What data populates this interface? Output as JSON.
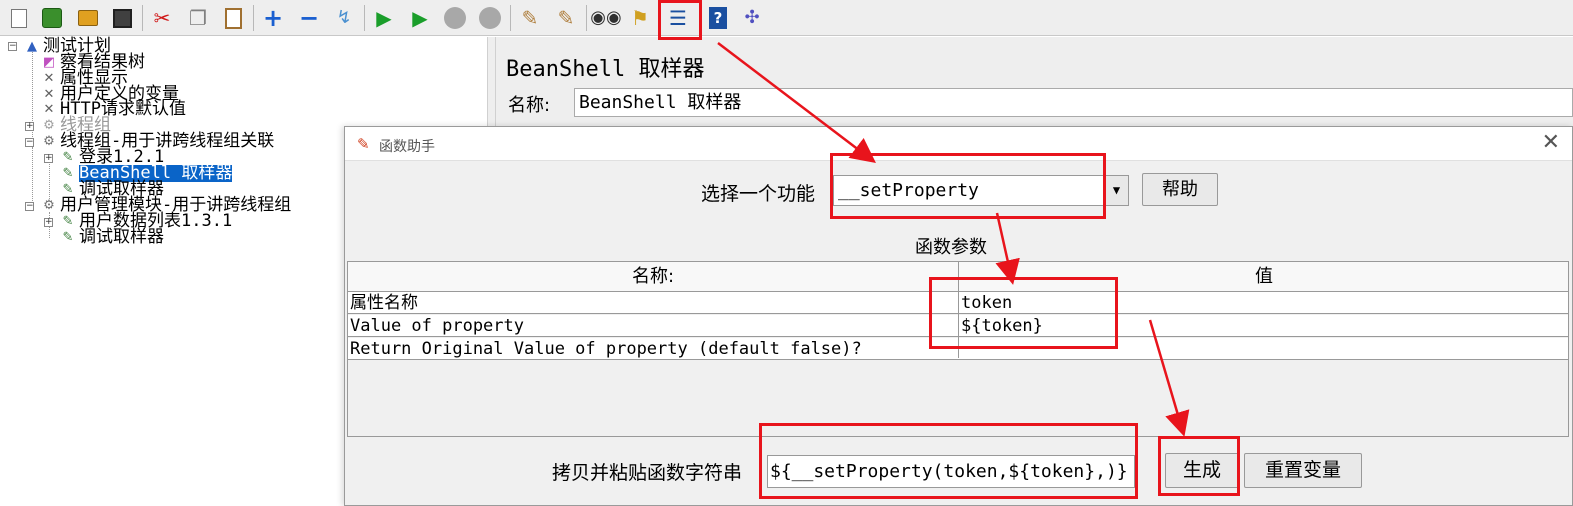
{
  "toolbar": {
    "buttons": [
      {
        "name": "new-icon",
        "glyph": "🗋",
        "color": "#ffffff"
      },
      {
        "name": "templates-icon",
        "glyph": "▦",
        "color": "#3a8f2c"
      },
      {
        "name": "open-icon",
        "glyph": "▬",
        "color": "#e0a020"
      },
      {
        "name": "save-icon",
        "glyph": "▣",
        "color": "#404040"
      },
      {
        "name": "cut-icon",
        "glyph": "✂",
        "color": "#d01818"
      },
      {
        "name": "copy-icon",
        "glyph": "❐",
        "color": "#808080"
      },
      {
        "name": "paste-icon",
        "glyph": "▤",
        "color": "#a07030"
      },
      {
        "name": "expand-icon",
        "glyph": "+",
        "color": "#1a5fd0"
      },
      {
        "name": "collapse-icon",
        "glyph": "−",
        "color": "#1a5fd0"
      },
      {
        "name": "toggle-icon",
        "glyph": "↯",
        "color": "#4a90d0"
      },
      {
        "name": "start-icon",
        "glyph": "▶",
        "color": "#1a9e2a"
      },
      {
        "name": "start-no-pause-icon",
        "glyph": "▶",
        "color": "#1a9e2a"
      },
      {
        "name": "stop-icon",
        "glyph": "⬢",
        "color": "#a0a0a0"
      },
      {
        "name": "shutdown-icon",
        "glyph": "✖",
        "color": "#a0a0a0"
      },
      {
        "name": "clear-icon",
        "glyph": "✎",
        "color": "#b08040"
      },
      {
        "name": "clear-all-icon",
        "glyph": "✎",
        "color": "#b08040"
      },
      {
        "name": "search-icon",
        "glyph": "👓",
        "color": "#303030"
      },
      {
        "name": "reset-search-icon",
        "glyph": "🧹",
        "color": "#d0a020"
      },
      {
        "name": "function-helper-icon",
        "glyph": "☰",
        "color": "#1a4fa0"
      },
      {
        "name": "help-icon",
        "glyph": "?",
        "color": "#1a4fa0"
      },
      {
        "name": "remote-icon",
        "glyph": "✣",
        "color": "#5050c0"
      }
    ]
  },
  "tree": {
    "nodes": [
      {
        "label": "测试计划",
        "icon": "flask-icon",
        "glyph": "▲",
        "color": "#3060c0",
        "depth": 0
      },
      {
        "label": "察看结果树",
        "icon": "listener-icon",
        "glyph": "◩",
        "color": "#c050c0",
        "depth": 1
      },
      {
        "label": "属性显示",
        "icon": "config-icon",
        "glyph": "✕",
        "color": "#606060",
        "depth": 1
      },
      {
        "label": "用户定义的变量",
        "icon": "config-icon",
        "glyph": "✕",
        "color": "#606060",
        "depth": 1
      },
      {
        "label": "HTTP请求默认值",
        "icon": "config-icon",
        "glyph": "✕",
        "color": "#606060",
        "depth": 1
      },
      {
        "label": "线程组",
        "icon": "thread-group-icon",
        "glyph": "⚙",
        "color": "#a0a0a0",
        "depth": 1
      },
      {
        "label": "线程组-用于讲跨线程组关联",
        "icon": "thread-group-icon",
        "glyph": "⚙",
        "color": "#707070",
        "depth": 1
      },
      {
        "label": "登录1.2.1",
        "icon": "sampler-icon",
        "glyph": "✎",
        "color": "#408040",
        "depth": 2
      },
      {
        "label": "BeanShell 取样器",
        "icon": "sampler-icon",
        "glyph": "✎",
        "color": "#408040",
        "depth": 2
      },
      {
        "label": "调试取样器",
        "icon": "sampler-icon",
        "glyph": "✎",
        "color": "#408040",
        "depth": 2
      },
      {
        "label": "用户管理模块-用于讲跨线程组",
        "icon": "thread-group-icon",
        "glyph": "⚙",
        "color": "#707070",
        "depth": 1
      },
      {
        "label": "用户数据列表1.3.1",
        "icon": "sampler-icon",
        "glyph": "✎",
        "color": "#408040",
        "depth": 2
      },
      {
        "label": "调试取样器",
        "icon": "sampler-icon",
        "glyph": "✎",
        "color": "#408040",
        "depth": 2
      }
    ]
  },
  "panel": {
    "title": "BeanShell 取样器",
    "name_label": "名称:",
    "name_value": "BeanShell 取样器"
  },
  "dialog": {
    "title": "函数助手",
    "close_glyph": "✕",
    "feature_label": "选择一个功能",
    "feature_value": "__setProperty",
    "dropdown_glyph": "▼",
    "help_label": "帮助",
    "params_title": "函数参数",
    "table": {
      "headers": [
        "名称:",
        "值"
      ],
      "rows": [
        [
          "属性名称",
          "token"
        ],
        [
          "Value of property",
          "${token}"
        ],
        [
          "Return Original Value of property (default false)?",
          ""
        ]
      ]
    },
    "copy_label": "拷贝并粘贴函数字符串",
    "function_string": "${__setProperty(token,${token},)}",
    "generate_label": "生成",
    "reset_label": "重置变量"
  },
  "annotation_color": "#e8141c"
}
